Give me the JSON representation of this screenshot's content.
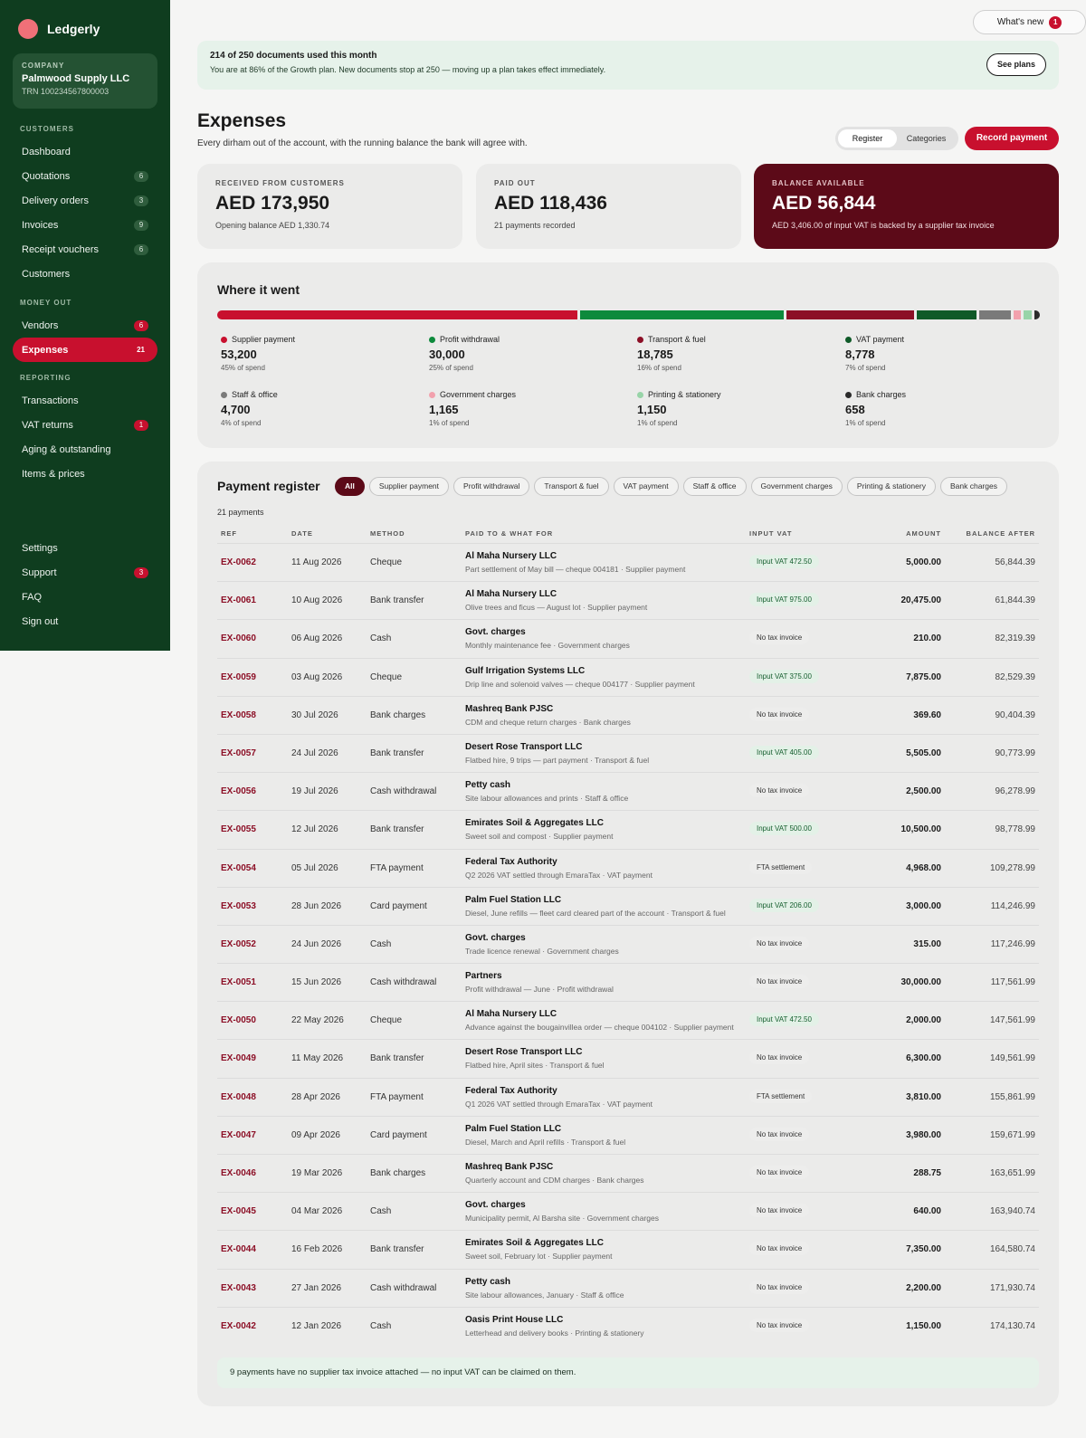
{
  "sidebar": {
    "brand": "Ledgerly",
    "company_label": "COMPANY",
    "company_name": "Palmwood Supply LLC",
    "company_trn": "TRN 100234567800003",
    "sections": [
      {
        "title": "CUSTOMERS",
        "items": [
          {
            "label": "Dashboard",
            "badge": ""
          },
          {
            "label": "Quotations",
            "badge": "6"
          },
          {
            "label": "Delivery orders",
            "badge": "3"
          },
          {
            "label": "Invoices",
            "badge": "9"
          },
          {
            "label": "Receipt vouchers",
            "badge": "6"
          },
          {
            "label": "Customers",
            "badge": ""
          }
        ]
      },
      {
        "title": "MONEY OUT",
        "items": [
          {
            "label": "Vendors",
            "badge": "6",
            "badge_red": true
          },
          {
            "label": "Expenses",
            "badge": "21",
            "active": true
          }
        ]
      },
      {
        "title": "REPORTING",
        "items": [
          {
            "label": "Transactions",
            "badge": ""
          },
          {
            "label": "VAT returns",
            "badge": "1",
            "badge_red": true
          },
          {
            "label": "Aging & outstanding",
            "badge": ""
          },
          {
            "label": "Items & prices",
            "badge": ""
          }
        ]
      }
    ],
    "footer_items": [
      {
        "label": "Settings",
        "badge": ""
      },
      {
        "label": "Support",
        "badge": "3",
        "badge_red": true
      },
      {
        "label": "FAQ",
        "badge": ""
      },
      {
        "label": "Sign out",
        "badge": ""
      }
    ]
  },
  "header": {
    "whats_new": "What's new",
    "whats_new_count": "1"
  },
  "banner": {
    "title": "214 of 250 documents used this month",
    "subtitle": "You are at 86% of the Growth plan. New documents stop at 250 — moving up a plan takes effect immediately.",
    "button": "See plans"
  },
  "page": {
    "title": "Expenses",
    "subtitle": "Every dirham out of the account, with the running balance the bank will agree with.",
    "tabs": [
      "Register",
      "Categories"
    ],
    "active_tab": "Register",
    "primary_button": "Record payment"
  },
  "kpis": [
    {
      "label": "RECEIVED FROM CUSTOMERS",
      "value": "AED 173,950",
      "sub": "Opening balance AED 1,330.74"
    },
    {
      "label": "PAID OUT",
      "value": "AED 118,436",
      "sub": "21 payments recorded"
    },
    {
      "label": "BALANCE AVAILABLE",
      "value": "AED 56,844",
      "sub": "AED 3,406.00 of input VAT is backed by a supplier tax invoice"
    }
  ],
  "breakdown": {
    "title": "Where it went",
    "categories": [
      {
        "name": "Supplier payment",
        "value": "53,200",
        "pct": "45% of spend",
        "amount": 53200,
        "color": "#c8102e"
      },
      {
        "name": "Profit withdrawal",
        "value": "30,000",
        "pct": "25% of spend",
        "amount": 30000,
        "color": "#0d8a3c"
      },
      {
        "name": "Transport & fuel",
        "value": "18,785",
        "pct": "16% of spend",
        "amount": 18785,
        "color": "#8c0f26"
      },
      {
        "name": "VAT payment",
        "value": "8,778",
        "pct": "7% of spend",
        "amount": 8778,
        "color": "#0f5a28"
      },
      {
        "name": "Staff & office",
        "value": "4,700",
        "pct": "4% of spend",
        "amount": 4700,
        "color": "#7a7a7a"
      },
      {
        "name": "Government charges",
        "value": "1,165",
        "pct": "1% of spend",
        "amount": 1165,
        "color": "#f2a1ad"
      },
      {
        "name": "Printing & stationery",
        "value": "1,150",
        "pct": "1% of spend",
        "amount": 1150,
        "color": "#98d4a8"
      },
      {
        "name": "Bank charges",
        "value": "658",
        "pct": "1% of spend",
        "amount": 658,
        "color": "#2b2b2b"
      }
    ]
  },
  "register": {
    "title": "Payment register",
    "filters": [
      "All",
      "Supplier payment",
      "Profit withdrawal",
      "Transport & fuel",
      "VAT payment",
      "Staff & office",
      "Government charges",
      "Printing & stationery",
      "Bank charges"
    ],
    "active_filter": "All",
    "count": "21 payments",
    "columns": [
      "REF",
      "DATE",
      "METHOD",
      "PAID TO & WHAT FOR",
      "INPUT VAT",
      "AMOUNT",
      "BALANCE AFTER"
    ],
    "rows": [
      {
        "ref": "EX-0062",
        "date": "11 Aug 2026",
        "method": "Cheque",
        "payee": "Al Maha Nursery LLC",
        "desc": "Part settlement of May bill — cheque 004181 · Supplier payment",
        "vat": "Input VAT 472.50",
        "vat_green": true,
        "amount": "5,000.00",
        "balance": "56,844.39"
      },
      {
        "ref": "EX-0061",
        "date": "10 Aug 2026",
        "method": "Bank transfer",
        "payee": "Al Maha Nursery LLC",
        "desc": "Olive trees and ficus — August lot · Supplier payment",
        "vat": "Input VAT 975.00",
        "vat_green": true,
        "amount": "20,475.00",
        "balance": "61,844.39"
      },
      {
        "ref": "EX-0060",
        "date": "06 Aug 2026",
        "method": "Cash",
        "payee": "Govt. charges",
        "desc": "Monthly maintenance fee · Government charges",
        "vat": "No tax invoice",
        "vat_green": false,
        "amount": "210.00",
        "balance": "82,319.39"
      },
      {
        "ref": "EX-0059",
        "date": "03 Aug 2026",
        "method": "Cheque",
        "payee": "Gulf Irrigation Systems LLC",
        "desc": "Drip line and solenoid valves — cheque 004177 · Supplier payment",
        "vat": "Input VAT 375.00",
        "vat_green": true,
        "amount": "7,875.00",
        "balance": "82,529.39"
      },
      {
        "ref": "EX-0058",
        "date": "30 Jul 2026",
        "method": "Bank charges",
        "payee": "Mashreq Bank PJSC",
        "desc": "CDM and cheque return charges · Bank charges",
        "vat": "No tax invoice",
        "vat_green": false,
        "amount": "369.60",
        "balance": "90,404.39"
      },
      {
        "ref": "EX-0057",
        "date": "24 Jul 2026",
        "method": "Bank transfer",
        "payee": "Desert Rose Transport LLC",
        "desc": "Flatbed hire, 9 trips — part payment · Transport & fuel",
        "vat": "Input VAT 405.00",
        "vat_green": true,
        "amount": "5,505.00",
        "balance": "90,773.99"
      },
      {
        "ref": "EX-0056",
        "date": "19 Jul 2026",
        "method": "Cash withdrawal",
        "payee": "Petty cash",
        "desc": "Site labour allowances and prints · Staff & office",
        "vat": "No tax invoice",
        "vat_green": false,
        "amount": "2,500.00",
        "balance": "96,278.99"
      },
      {
        "ref": "EX-0055",
        "date": "12 Jul 2026",
        "method": "Bank transfer",
        "payee": "Emirates Soil & Aggregates LLC",
        "desc": "Sweet soil and compost · Supplier payment",
        "vat": "Input VAT 500.00",
        "vat_green": true,
        "amount": "10,500.00",
        "balance": "98,778.99"
      },
      {
        "ref": "EX-0054",
        "date": "05 Jul 2026",
        "method": "FTA payment",
        "payee": "Federal Tax Authority",
        "desc": "Q2 2026 VAT settled through EmaraTax · VAT payment",
        "vat": "FTA settlement",
        "vat_green": false,
        "amount": "4,968.00",
        "balance": "109,278.99"
      },
      {
        "ref": "EX-0053",
        "date": "28 Jun 2026",
        "method": "Card payment",
        "payee": "Palm Fuel Station LLC",
        "desc": "Diesel, June refills — fleet card cleared part of the account · Transport & fuel",
        "vat": "Input VAT 206.00",
        "vat_green": true,
        "amount": "3,000.00",
        "balance": "114,246.99"
      },
      {
        "ref": "EX-0052",
        "date": "24 Jun 2026",
        "method": "Cash",
        "payee": "Govt. charges",
        "desc": "Trade licence renewal · Government charges",
        "vat": "No tax invoice",
        "vat_green": false,
        "amount": "315.00",
        "balance": "117,246.99"
      },
      {
        "ref": "EX-0051",
        "date": "15 Jun 2026",
        "method": "Cash withdrawal",
        "payee": "Partners",
        "desc": "Profit withdrawal — June · Profit withdrawal",
        "vat": "No tax invoice",
        "vat_green": false,
        "amount": "30,000.00",
        "balance": "117,561.99"
      },
      {
        "ref": "EX-0050",
        "date": "22 May 2026",
        "method": "Cheque",
        "payee": "Al Maha Nursery LLC",
        "desc": "Advance against the bougainvillea order — cheque 004102 · Supplier payment",
        "vat": "Input VAT 472.50",
        "vat_green": true,
        "amount": "2,000.00",
        "balance": "147,561.99"
      },
      {
        "ref": "EX-0049",
        "date": "11 May 2026",
        "method": "Bank transfer",
        "payee": "Desert Rose Transport LLC",
        "desc": "Flatbed hire, April sites · Transport & fuel",
        "vat": "No tax invoice",
        "vat_green": false,
        "amount": "6,300.00",
        "balance": "149,561.99"
      },
      {
        "ref": "EX-0048",
        "date": "28 Apr 2026",
        "method": "FTA payment",
        "payee": "Federal Tax Authority",
        "desc": "Q1 2026 VAT settled through EmaraTax · VAT payment",
        "vat": "FTA settlement",
        "vat_green": false,
        "amount": "3,810.00",
        "balance": "155,861.99"
      },
      {
        "ref": "EX-0047",
        "date": "09 Apr 2026",
        "method": "Card payment",
        "payee": "Palm Fuel Station LLC",
        "desc": "Diesel, March and April refills · Transport & fuel",
        "vat": "No tax invoice",
        "vat_green": false,
        "amount": "3,980.00",
        "balance": "159,671.99"
      },
      {
        "ref": "EX-0046",
        "date": "19 Mar 2026",
        "method": "Bank charges",
        "payee": "Mashreq Bank PJSC",
        "desc": "Quarterly account and CDM charges · Bank charges",
        "vat": "No tax invoice",
        "vat_green": false,
        "amount": "288.75",
        "balance": "163,651.99"
      },
      {
        "ref": "EX-0045",
        "date": "04 Mar 2026",
        "method": "Cash",
        "payee": "Govt. charges",
        "desc": "Municipality permit, Al Barsha site · Government charges",
        "vat": "No tax invoice",
        "vat_green": false,
        "amount": "640.00",
        "balance": "163,940.74"
      },
      {
        "ref": "EX-0044",
        "date": "16 Feb 2026",
        "method": "Bank transfer",
        "payee": "Emirates Soil & Aggregates LLC",
        "desc": "Sweet soil, February lot · Supplier payment",
        "vat": "No tax invoice",
        "vat_green": false,
        "amount": "7,350.00",
        "balance": "164,580.74"
      },
      {
        "ref": "EX-0043",
        "date": "27 Jan 2026",
        "method": "Cash withdrawal",
        "payee": "Petty cash",
        "desc": "Site labour allowances, January · Staff & office",
        "vat": "No tax invoice",
        "vat_green": false,
        "amount": "2,200.00",
        "balance": "171,930.74"
      },
      {
        "ref": "EX-0042",
        "date": "12 Jan 2026",
        "method": "Cash",
        "payee": "Oasis Print House LLC",
        "desc": "Letterhead and delivery books · Printing & stationery",
        "vat": "No tax invoice",
        "vat_green": false,
        "amount": "1,150.00",
        "balance": "174,130.74"
      }
    ],
    "note": "9 payments have no supplier tax invoice attached — no input VAT can be claimed on them."
  }
}
